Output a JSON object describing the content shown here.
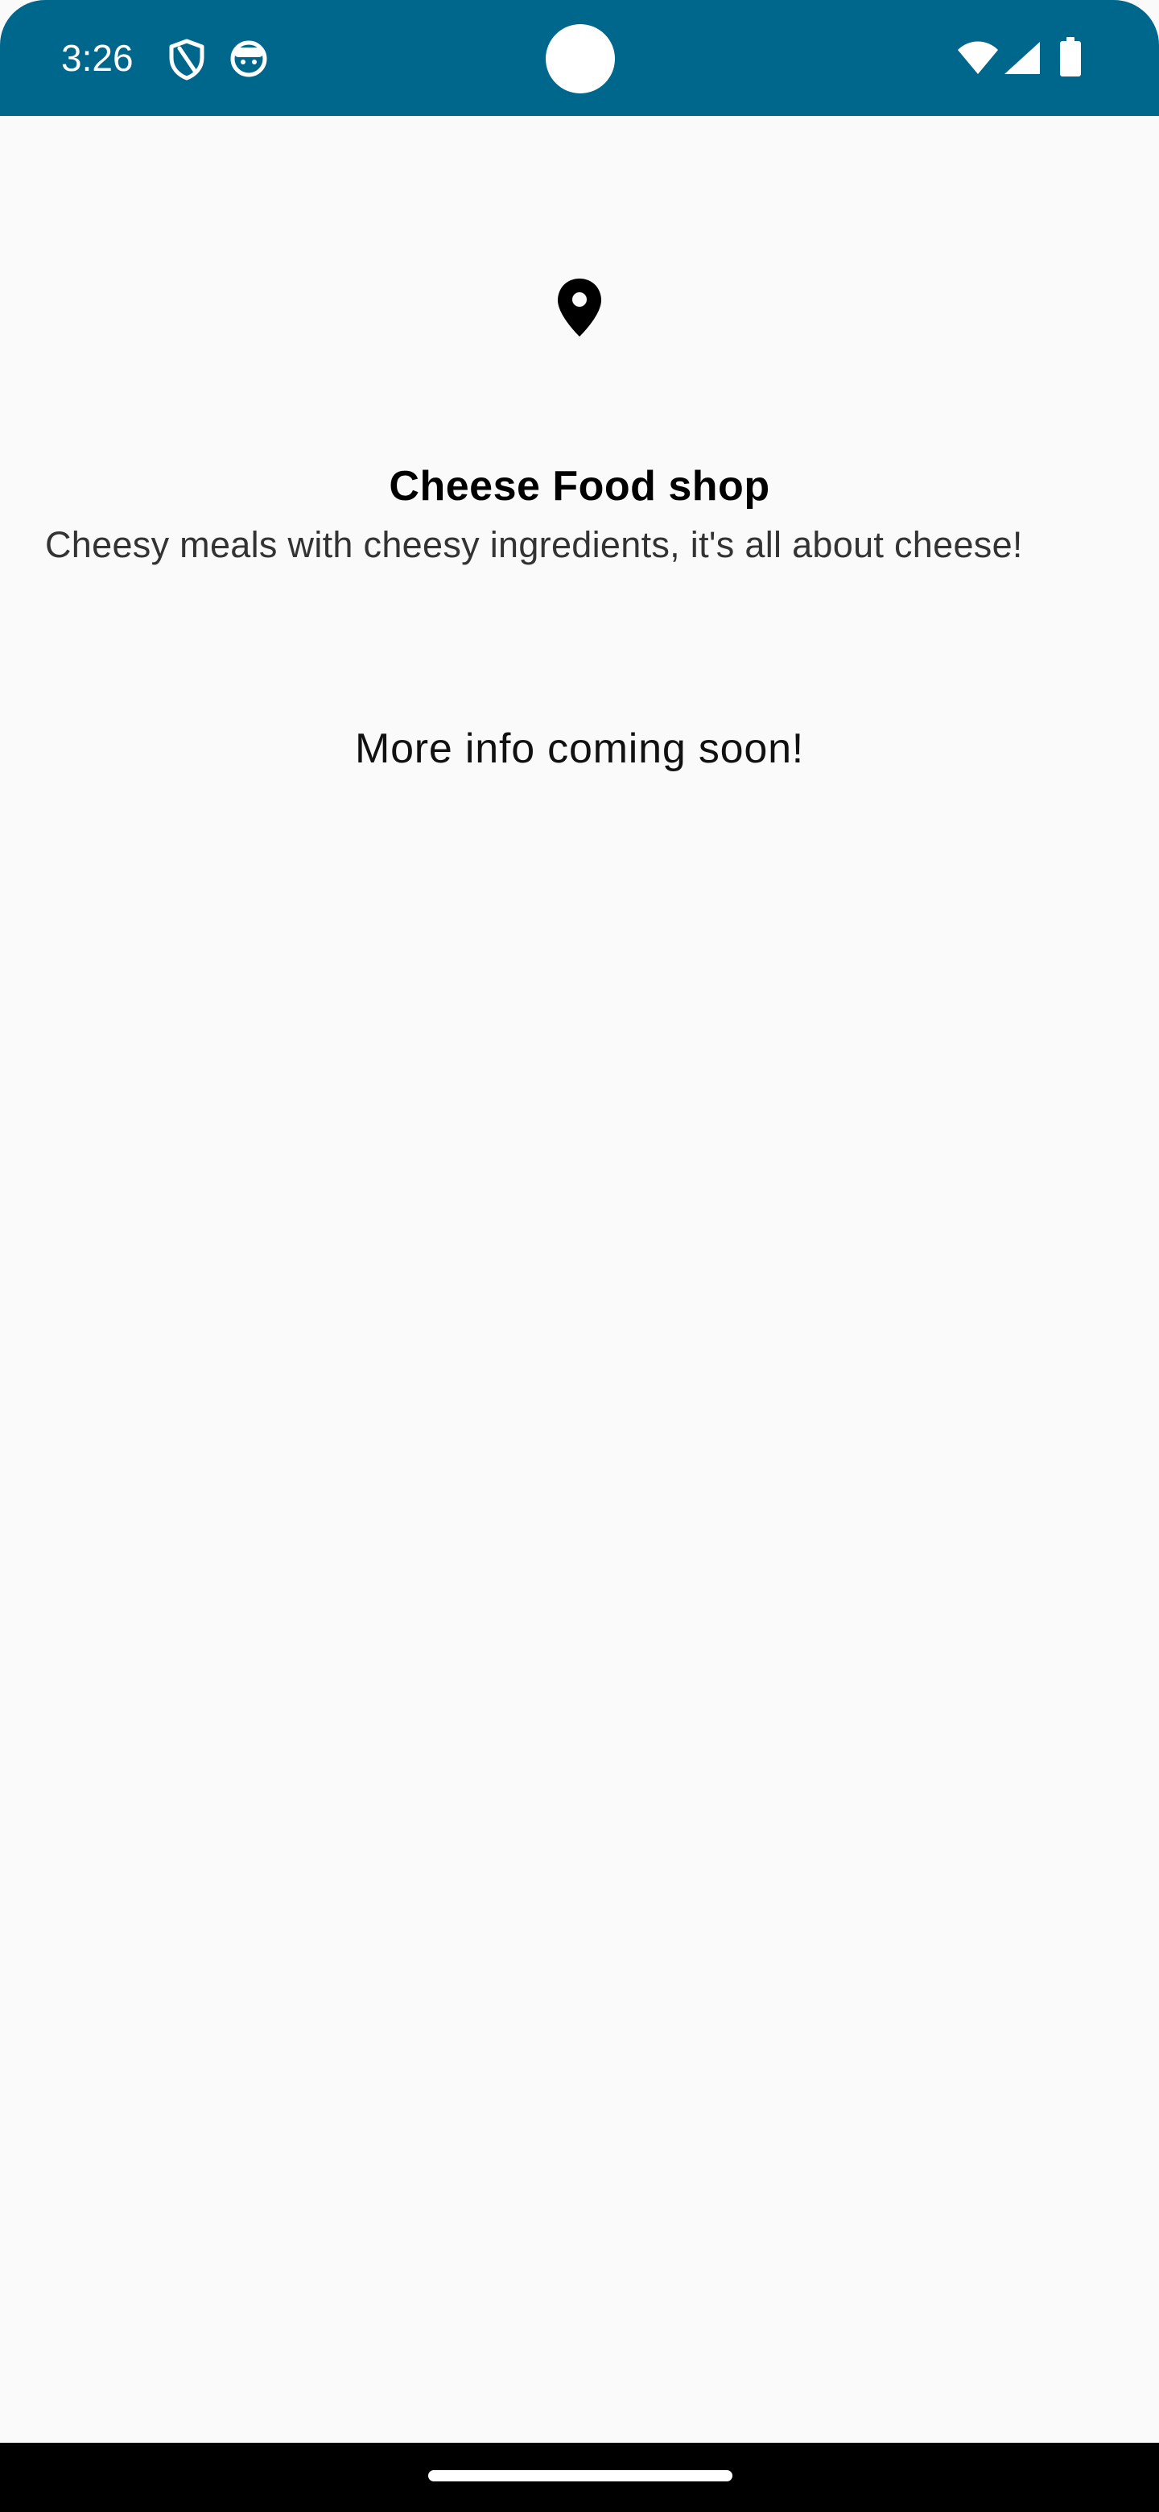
{
  "status_bar": {
    "time": "3:26",
    "background_color": "#00678c",
    "left_icons": [
      "shield-icon",
      "android-face-icon"
    ],
    "right_icons": [
      "wifi-icon",
      "cellular-signal-icon",
      "battery-icon"
    ]
  },
  "shop": {
    "icon": "location-pin-icon",
    "title": "Cheese Food shop",
    "description": "Cheesy meals with cheesy ingredients, it's all about cheese!",
    "more_info": "More info coming soon!"
  },
  "navigation_bar": {
    "background_color": "#000000",
    "home_indicator": "home-indicator"
  }
}
